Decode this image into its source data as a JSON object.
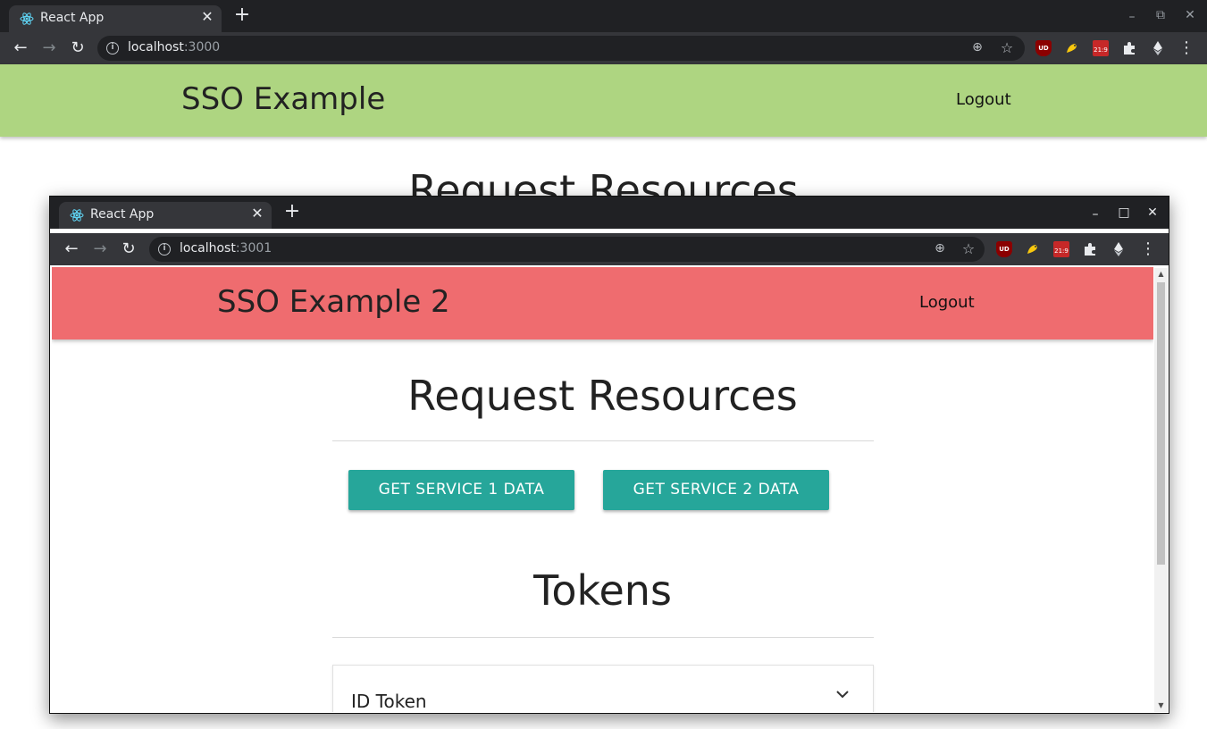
{
  "back_window": {
    "tab_title": "React App",
    "url_host": "localhost",
    "url_port": ":3000",
    "app": {
      "brand": "SSO Example",
      "logout_label": "Logout",
      "header_color": "#aed581",
      "section_heading": "Request Resources"
    }
  },
  "front_window": {
    "tab_title": "React App",
    "url_host": "localhost",
    "url_port": ":3001",
    "app": {
      "brand": "SSO Example 2",
      "logout_label": "Logout",
      "header_color": "#ef6c6f",
      "request_heading": "Request Resources",
      "buttons": {
        "service1": "GET SERVICE 1 DATA",
        "service2": "GET SERVICE 2 DATA"
      },
      "button_color": "#26a69a",
      "tokens_heading": "Tokens",
      "collapsible_items": [
        {
          "label": "ID Token"
        }
      ]
    }
  },
  "extensions": {
    "ublock_badge": "UD",
    "youtube_ratio": "21:9"
  },
  "icons": {
    "new_tab": "+",
    "close": "✕",
    "minimize": "–",
    "maximize": "□",
    "restore": "⧉",
    "back": "←",
    "forward": "→",
    "reload": "↻",
    "zoom": "⊕",
    "star": "☆",
    "menu": "⋮"
  }
}
